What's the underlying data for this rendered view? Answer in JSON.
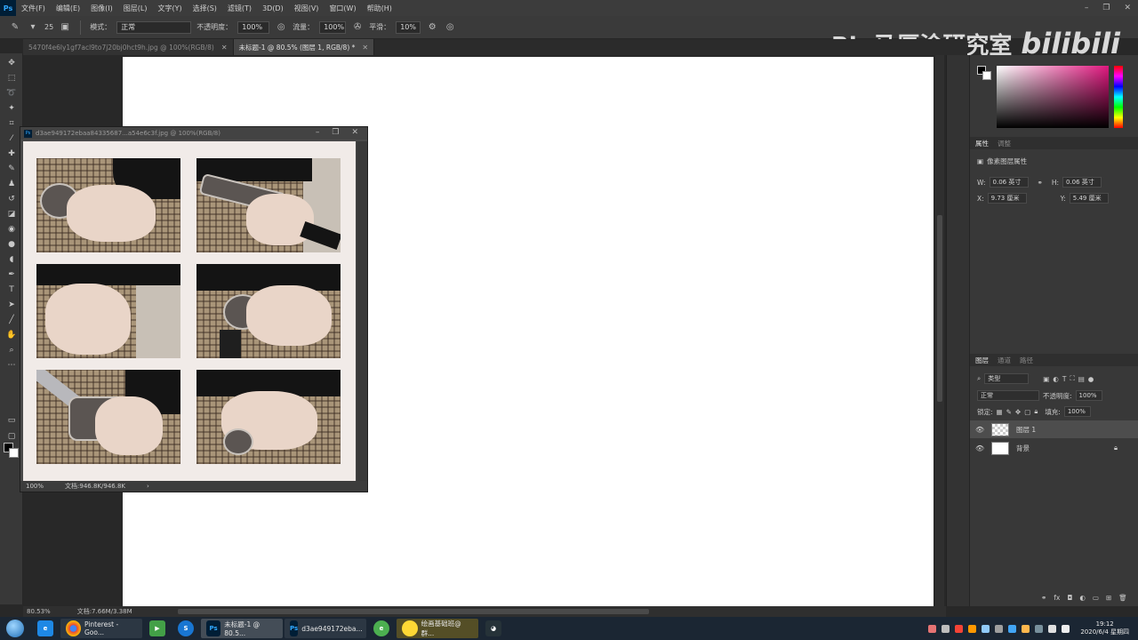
{
  "app": {
    "logo": "Ps"
  },
  "menu": [
    "文件(F)",
    "编辑(E)",
    "图像(I)",
    "图层(L)",
    "文字(Y)",
    "选择(S)",
    "滤镜(T)",
    "3D(D)",
    "视图(V)",
    "窗口(W)",
    "帮助(H)"
  ],
  "options": {
    "brush_size": "25",
    "mode_label": "模式：",
    "mode_value": "正常",
    "opacity_label": "不透明度：",
    "opacity_value": "100%",
    "flow_label": "流量：",
    "flow_value": "100%",
    "smooth_label": "平滑：",
    "smooth_value": "10%"
  },
  "watermark": {
    "text": "Big马厚涂研究室",
    "brand": "bilibili"
  },
  "tabs": [
    {
      "label": "5470f4e6ly1gf7acl9to7j20bj0hct9h.jpg @ 100%(RGB/8)"
    },
    {
      "label": "未标题-1 @ 80.5% (图层 1, RGB/8) *"
    }
  ],
  "float_window": {
    "title": "d3ae949172ebaa84335687...a54e6c3f.jpg @ 100%(RGB/8)",
    "zoom": "100%",
    "doc_size": "文档:946.8K/946.8K"
  },
  "status": {
    "zoom": "80.53%",
    "doc_size": "文档:7.66M/3.38M"
  },
  "panels": {
    "props_tabs": [
      "属性",
      "调整"
    ],
    "props_title": "像素图层属性",
    "w_label": "W:",
    "w_value": "0.06 英寸",
    "h_label": "H:",
    "h_value": "0.06 英寸",
    "x_label": "X:",
    "x_value": "9.73 厘米",
    "y_label": "Y:",
    "y_value": "5.49 厘米",
    "layer_tabs": [
      "图层",
      "通道",
      "路径"
    ],
    "filter_label": "类型",
    "blend_mode": "正常",
    "opacity_label": "不透明度:",
    "opacity_value": "100%",
    "lock_label": "锁定:",
    "fill_label": "填充:",
    "fill_value": "100%",
    "layers": [
      {
        "name": "图层 1",
        "selected": true
      },
      {
        "name": "背景",
        "selected": false
      }
    ]
  },
  "taskbar": {
    "apps": [
      {
        "label": "Pinterest - Goo..."
      },
      {
        "label": "未标题-1 @ 80.5..."
      },
      {
        "label": "d3ae949172eba..."
      },
      {
        "label": "绘画基础班@群..."
      }
    ],
    "time": "19:12",
    "date": "2020/6/4 星期四"
  },
  "colors": {
    "accent": "#31a8ff",
    "panel": "#383838",
    "canvas": "#ffffff"
  }
}
